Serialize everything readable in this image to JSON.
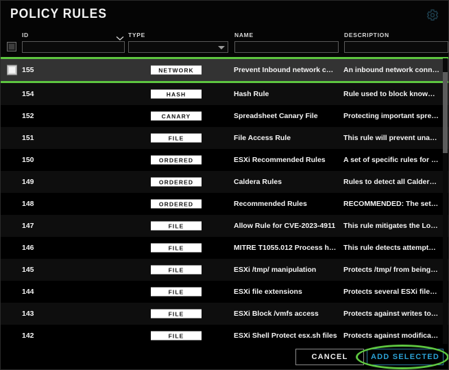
{
  "header": {
    "title": "POLICY RULES",
    "gear_icon": "gear-icon",
    "accent_green": "#5ec640",
    "accent_blue": "#2ba2d6"
  },
  "columns": [
    {
      "key": "id",
      "label": "ID",
      "sort_icon": "chevron-down-icon",
      "filter_type": "text",
      "filter_value": "",
      "filter_placeholder": ""
    },
    {
      "key": "type",
      "label": "TYPE",
      "sort_icon": "",
      "filter_type": "select",
      "filter_value": "",
      "filter_placeholder": ""
    },
    {
      "key": "name",
      "label": "NAME",
      "sort_icon": "",
      "filter_type": "text",
      "filter_value": "",
      "filter_placeholder": ""
    },
    {
      "key": "description",
      "label": "DESCRIPTION",
      "sort_icon": "",
      "filter_type": "text",
      "filter_value": "",
      "filter_placeholder": ""
    }
  ],
  "select_all_checkbox": {
    "checked": false,
    "indeterminate": true
  },
  "rows": [
    {
      "id": "155",
      "type": "NETWORK",
      "name": "Prevent Inbound network c…",
      "description": "An inbound network connec…",
      "selected": true,
      "checked": true
    },
    {
      "id": "154",
      "type": "HASH",
      "name": "Hash Rule",
      "description": "Rule used to block known m…",
      "selected": false,
      "checked": false
    },
    {
      "id": "152",
      "type": "CANARY",
      "name": "Spreadsheet Canary File",
      "description": "Protecting important sprea…",
      "selected": false,
      "checked": false
    },
    {
      "id": "151",
      "type": "FILE",
      "name": "File Access Rule",
      "description": "This rule will prevent unaut…",
      "selected": false,
      "checked": false
    },
    {
      "id": "150",
      "type": "ORDERED",
      "name": "ESXi Recommended Rules",
      "description": "A set of specific rules for pro…",
      "selected": false,
      "checked": false
    },
    {
      "id": "149",
      "type": "ORDERED",
      "name": "Caldera Rules",
      "description": "Rules to detect all Caldera Li…",
      "selected": false,
      "checked": false
    },
    {
      "id": "148",
      "type": "ORDERED",
      "name": "Recommended Rules",
      "description": "RECOMMENDED: The set of …",
      "selected": false,
      "checked": false
    },
    {
      "id": "147",
      "type": "FILE",
      "name": "Allow Rule for CVE-2023-4911",
      "description": "This rule mitigates the Loon…",
      "selected": false,
      "checked": false
    },
    {
      "id": "146",
      "type": "FILE",
      "name": "MITRE T1055.012 Process h…",
      "description": "This rule detects attempts t…",
      "selected": false,
      "checked": false
    },
    {
      "id": "145",
      "type": "FILE",
      "name": "ESXi /tmp/ manipulation",
      "description": "Protects /tmp/ from being m…",
      "selected": false,
      "checked": false
    },
    {
      "id": "144",
      "type": "FILE",
      "name": "ESXi file extensions",
      "description": "Protects several ESXi filetyp…",
      "selected": false,
      "checked": false
    },
    {
      "id": "143",
      "type": "FILE",
      "name": "ESXi Block /vmfs access",
      "description": "Protects against writes to /v…",
      "selected": false,
      "checked": false
    },
    {
      "id": "142",
      "type": "FILE",
      "name": "ESXi Shell Protect esx.sh files",
      "description": "Protects against modificatio…",
      "selected": false,
      "checked": false
    }
  ],
  "footer": {
    "cancel_label": "CANCEL",
    "add_selected_label": "ADD SELECTED"
  },
  "annotation": {
    "shape": "ellipse",
    "color": "#5ec640",
    "target": "add-selected-button"
  },
  "scrollbar": {
    "orientation": "vertical",
    "position_percent": 5
  }
}
